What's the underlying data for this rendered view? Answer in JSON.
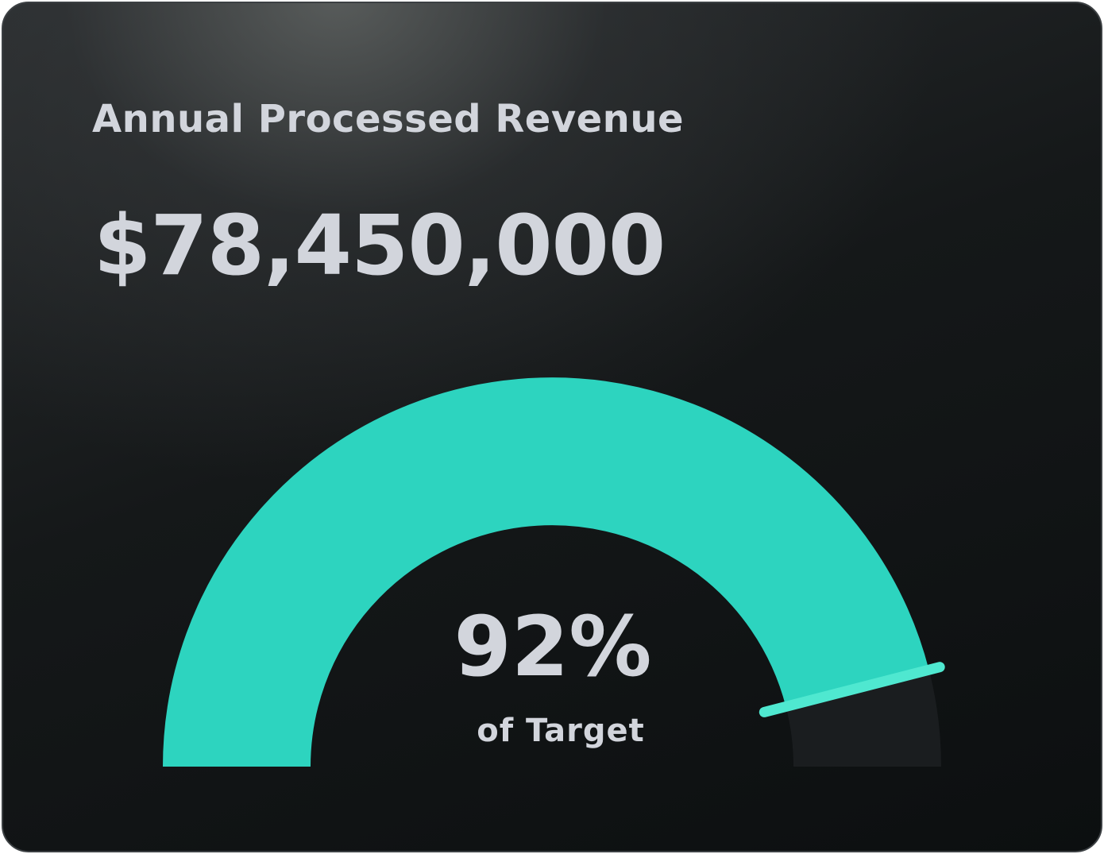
{
  "widget": {
    "title": "Annual Processed Revenue",
    "amount": "$78,450,000"
  },
  "gauge": {
    "percent_text": "92%",
    "caption": "of Target",
    "progress_fraction": 0.92,
    "colors": {
      "fill": "#2dd4bf",
      "track": "#1a1d1f",
      "marker": "#4fe8d0",
      "text": "#d2d5dc"
    }
  }
}
